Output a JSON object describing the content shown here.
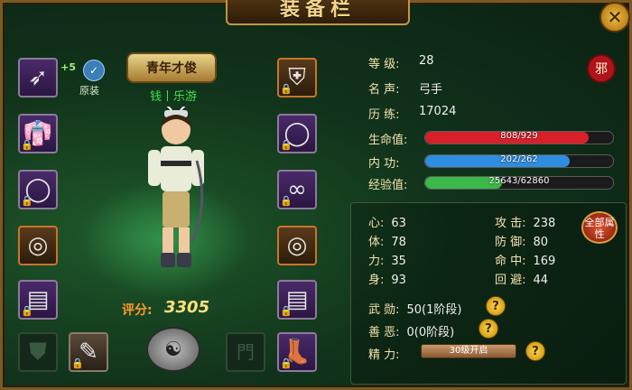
{
  "window": {
    "title": "装备栏",
    "close_label": "✕"
  },
  "equipment": {
    "upgrade_badge": "+5",
    "original_label": "原装",
    "youth_badge": "青年才俊",
    "character_name": "钱丨乐游",
    "score_label": "评分:",
    "score_value": "3305"
  },
  "info": {
    "level_key": "等  级:",
    "level": "28",
    "fame_key": "名  声:",
    "fame": "弓手",
    "exp_key": "历  练:",
    "exp": "17024",
    "faction_seal": "邪"
  },
  "bars": {
    "hp": {
      "label": "生命值:",
      "text": "808/929",
      "current": 808,
      "max": 929,
      "color": "#d8202a"
    },
    "mp": {
      "label": "内  功:",
      "text": "202/262",
      "current": 202,
      "max": 262,
      "color": "#2f8de0"
    },
    "xp": {
      "label": "经验值:",
      "text": "25643/62860",
      "current": 25643,
      "max": 62860,
      "color": "#3ab84a"
    }
  },
  "attributes": {
    "heart_k": "心:",
    "heart": "63",
    "body_k": "体:",
    "body": "78",
    "power_k": "力:",
    "power": "35",
    "agile_k": "身:",
    "agile": "93",
    "attack_k": "攻  击:",
    "attack": "238",
    "defense_k": "防  御:",
    "defense": "80",
    "hit_k": "命  中:",
    "hit": "169",
    "dodge_k": "回  避:",
    "dodge": "44",
    "all_attr_label": "全部属性",
    "merit_k": "武  勋:",
    "merit": "50(1阶段)",
    "karma_k": "善  恶:",
    "karma": "0(0阶段)",
    "energy_k": "精  力:",
    "energy": "30级开启"
  }
}
